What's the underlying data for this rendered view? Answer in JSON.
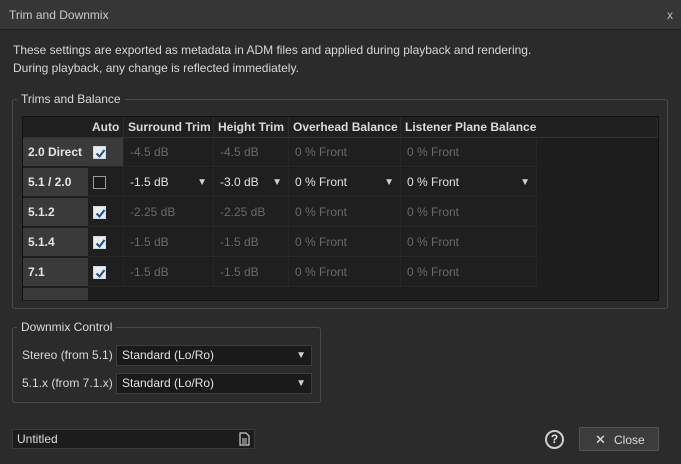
{
  "window": {
    "title": "Trim and Downmix",
    "close_glyph": "x"
  },
  "info": {
    "line1": "These settings are exported as metadata in ADM files and applied during playback and rendering.",
    "line2": "During playback, any change is reflected immediately."
  },
  "trims": {
    "legend": "Trims and Balance",
    "columns": [
      "Auto",
      "Surround Trim",
      "Height Trim",
      "Overhead Balance",
      "Listener Plane Balance"
    ],
    "rows": [
      {
        "name": "2.0 Direct",
        "auto": true,
        "surround": "-4.5 dB",
        "height": "-4.5 dB",
        "overhead": "0 % Front",
        "listener": "0 % Front"
      },
      {
        "name": "5.1 / 2.0",
        "auto": false,
        "surround": "-1.5 dB",
        "height": "-3.0 dB",
        "overhead": "0 % Front",
        "listener": "0 % Front"
      },
      {
        "name": "5.1.2",
        "auto": true,
        "surround": "-2.25 dB",
        "height": "-2.25 dB",
        "overhead": "0 % Front",
        "listener": "0 % Front"
      },
      {
        "name": "5.1.4",
        "auto": true,
        "surround": "-1.5 dB",
        "height": "-1.5 dB",
        "overhead": "0 % Front",
        "listener": "0 % Front"
      },
      {
        "name": "7.1",
        "auto": true,
        "surround": "-1.5 dB",
        "height": "-1.5 dB",
        "overhead": "0 % Front",
        "listener": "0 % Front"
      }
    ]
  },
  "downmix": {
    "legend": "Downmix Control",
    "stereo_label": "Stereo (from 5.1)",
    "stereo_value": "Standard (Lo/Ro)",
    "fiveone_label": "5.1.x (from 7.1.x)",
    "fiveone_value": "Standard (Lo/Ro)"
  },
  "footer": {
    "name_value": "Untitled",
    "help_glyph": "?",
    "close_label": "Close",
    "close_glyph": "✕"
  },
  "colors": {
    "background": "#2b2b2b",
    "grid": "#1d1d1d",
    "row_header": "#3a3a3a",
    "disabled_text": "#6a6a6a"
  }
}
